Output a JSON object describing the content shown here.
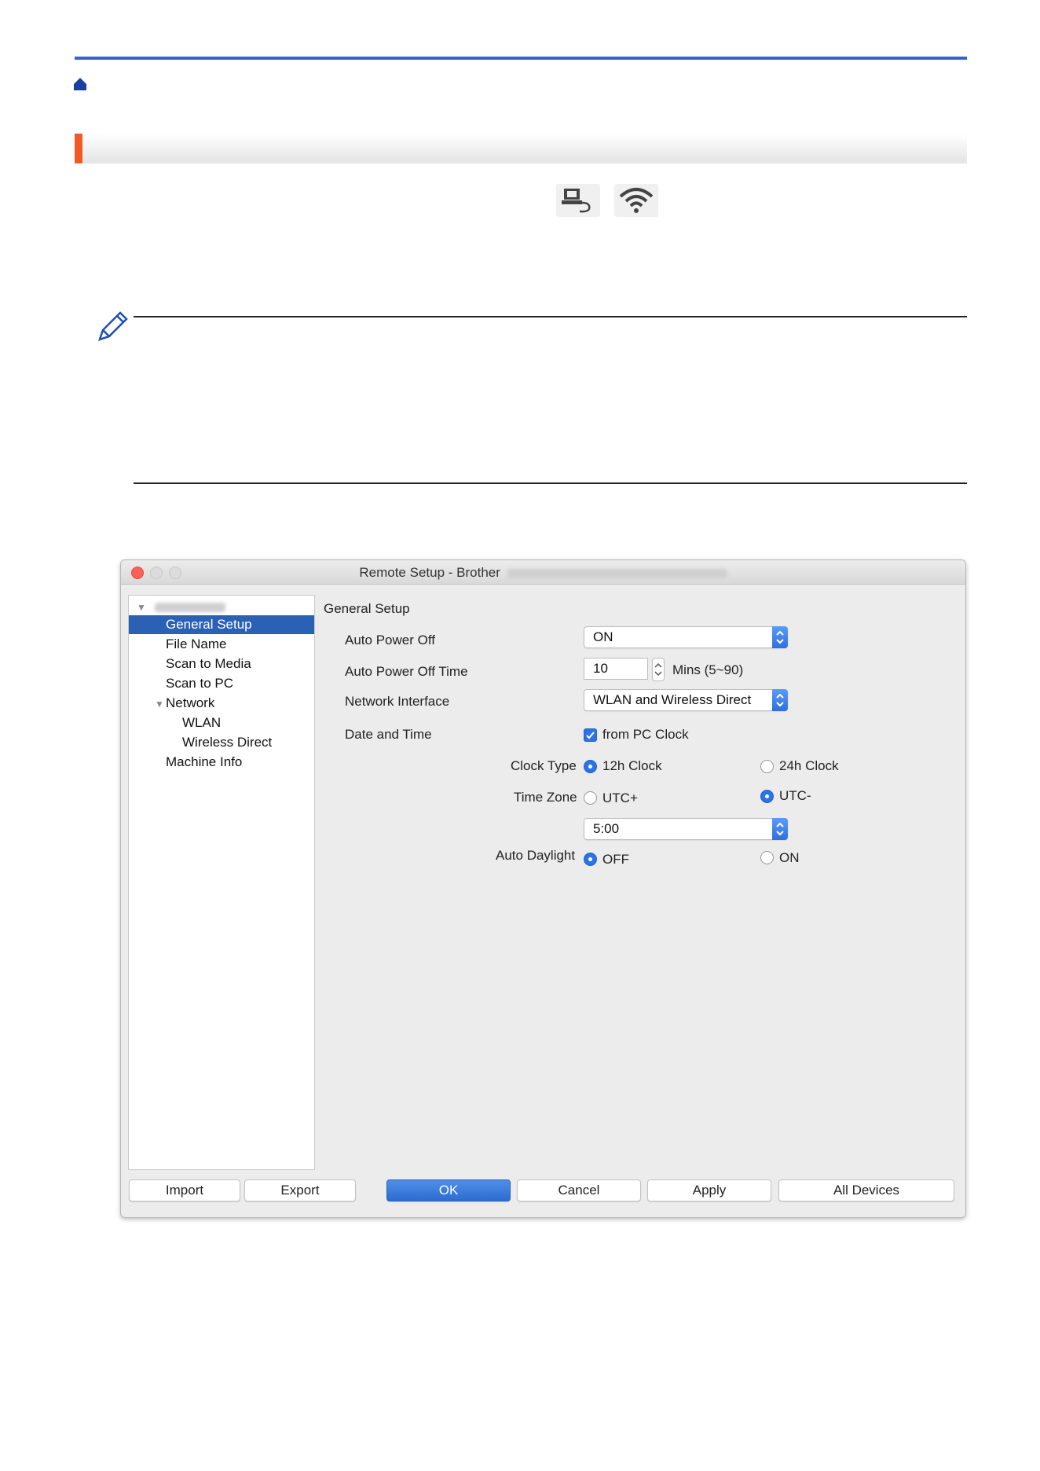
{
  "document": {
    "icons": [
      "home-icon",
      "usb-icon",
      "wifi-icon",
      "pencil-note-icon"
    ]
  },
  "window": {
    "title": "Remote Setup - Brother",
    "sidebar": {
      "items": [
        {
          "label": "General Setup",
          "selected": true
        },
        {
          "label": "File Name"
        },
        {
          "label": "Scan to Media"
        },
        {
          "label": "Scan to PC"
        },
        {
          "label": "Network"
        },
        {
          "label": "WLAN"
        },
        {
          "label": "Wireless Direct"
        },
        {
          "label": "Machine Info"
        }
      ]
    },
    "panel": {
      "heading": "General Setup",
      "auto_power_off": {
        "label": "Auto Power Off",
        "value": "ON"
      },
      "auto_power_off_time": {
        "label": "Auto Power Off Time",
        "value": "10",
        "unit": "Mins (5~90)"
      },
      "network_interface": {
        "label": "Network Interface",
        "value": "WLAN and Wireless Direct"
      },
      "date_time": {
        "label": "Date and Time",
        "checkbox_label": "from PC Clock",
        "checked": true
      },
      "clock_type": {
        "label": "Clock Type",
        "option_a": "12h Clock",
        "option_b": "24h Clock",
        "selected": "12h Clock"
      },
      "time_zone": {
        "label": "Time Zone",
        "option_a": "UTC+",
        "option_b": "UTC-",
        "selected": "UTC-",
        "offset": "5:00"
      },
      "auto_daylight": {
        "label": "Auto Daylight",
        "option_a": "OFF",
        "option_b": "ON",
        "selected": "OFF"
      }
    },
    "buttons": {
      "import": "Import",
      "export": "Export",
      "ok": "OK",
      "cancel": "Cancel",
      "apply": "Apply",
      "all_devices": "All Devices"
    }
  }
}
